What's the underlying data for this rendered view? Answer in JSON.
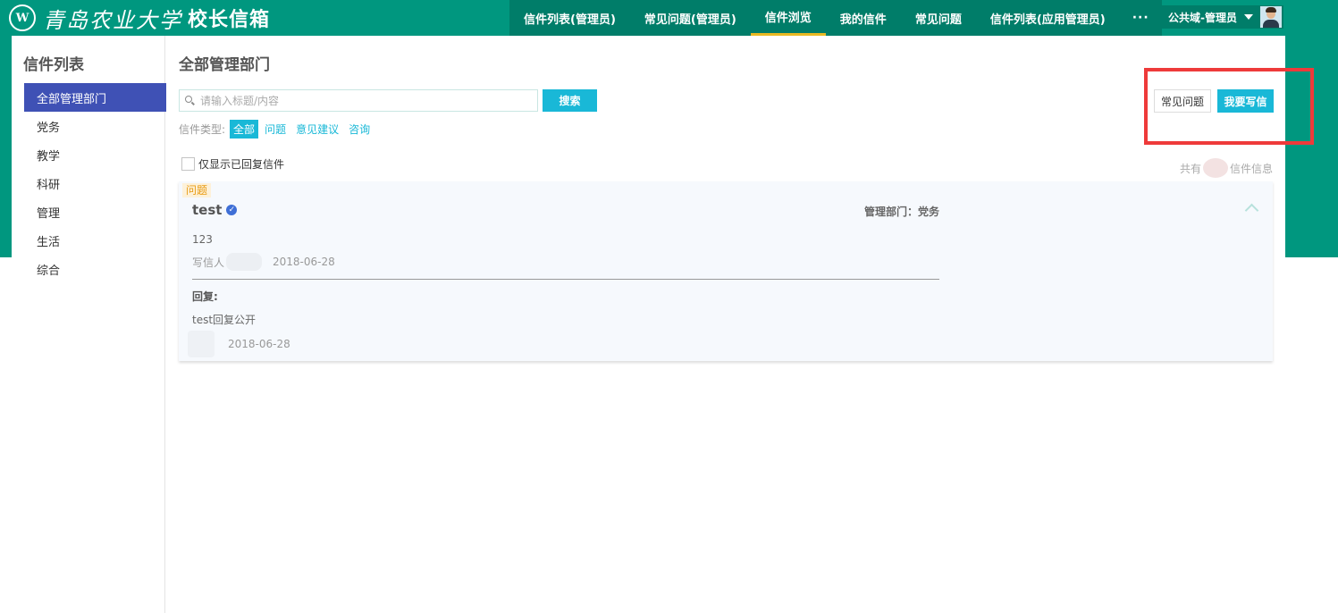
{
  "theme": {
    "primary": "#00977f",
    "nav_dark": "#007d69",
    "accent": "#19b8d7",
    "sidebar_active": "#3f51b5",
    "nav_active_underline": "#e8b923",
    "highlight": "#ee3a3a"
  },
  "brand": {
    "logo_text": "W",
    "school_name": "青岛农业大学",
    "system_name": "校长信箱"
  },
  "nav": {
    "items": [
      {
        "label": "信件列表(管理员)",
        "active": false
      },
      {
        "label": "常见问题(管理员)",
        "active": false
      },
      {
        "label": "信件浏览",
        "active": true
      },
      {
        "label": "我的信件",
        "active": false
      },
      {
        "label": "常见问题",
        "active": false
      },
      {
        "label": "信件列表(应用管理员)",
        "active": false
      }
    ],
    "more_label": "···"
  },
  "user": {
    "name": "公共域-管理员"
  },
  "sidebar": {
    "title": "信件列表",
    "items": [
      {
        "label": "全部管理部门",
        "active": true
      },
      {
        "label": "党务",
        "active": false
      },
      {
        "label": "教学",
        "active": false
      },
      {
        "label": "科研",
        "active": false
      },
      {
        "label": "管理",
        "active": false
      },
      {
        "label": "生活",
        "active": false
      },
      {
        "label": "综合",
        "active": false
      }
    ]
  },
  "main": {
    "title": "全部管理部门",
    "search": {
      "placeholder": "请输入标题/内容",
      "value": "",
      "button_label": "搜索"
    },
    "types": {
      "label": "信件类型:",
      "options": [
        {
          "label": "全部",
          "active": true
        },
        {
          "label": "问题",
          "active": false
        },
        {
          "label": "意见建议",
          "active": false
        },
        {
          "label": "咨询",
          "active": false
        }
      ]
    },
    "actions": {
      "faq_label": "常见问题",
      "write_label": "我要写信"
    },
    "filter": {
      "replied_only_label": "仅显示已回复信件",
      "checked": false
    },
    "count": {
      "prefix": "共有",
      "suffix": "信件信息"
    },
    "letters": [
      {
        "type_tag": "问题",
        "subject": "test",
        "dept": "管理部门：党务",
        "content": "123",
        "writer_label": "写信人",
        "date": "2018-06-28",
        "reply_label": "回复:",
        "reply_content": "test回复公开",
        "reply_date": "2018-06-28"
      }
    ]
  }
}
